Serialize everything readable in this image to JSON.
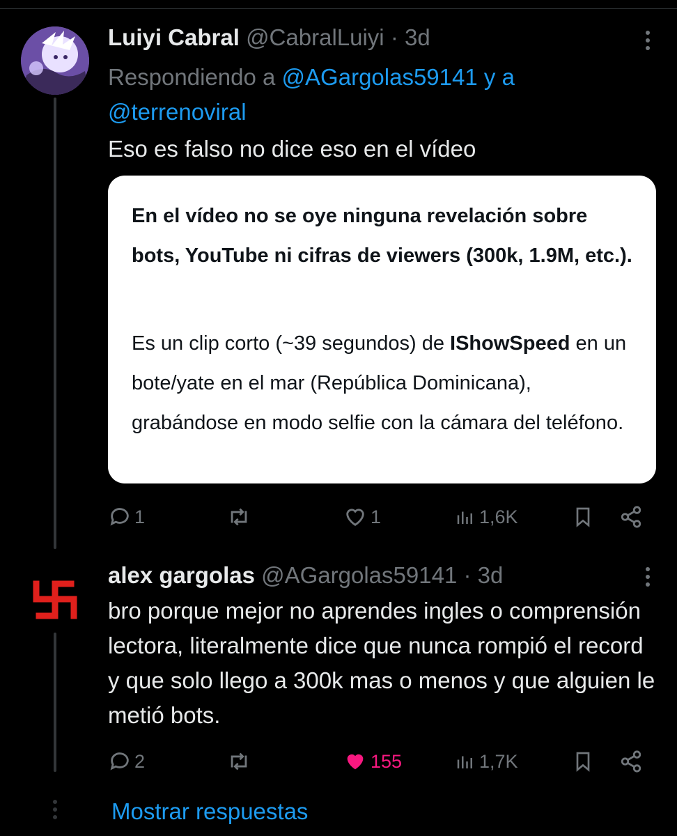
{
  "tweet1": {
    "author_name": "Luiyi Cabral",
    "handle": "@CabralLuiyi",
    "separator": "·",
    "time": "3d",
    "reply_prefix": "Respondiendo a",
    "reply_user1": "@AGargolas59141",
    "reply_and": "y a",
    "reply_user2": "@terrenoviral",
    "text": "Eso es falso no dice eso en el vídeo",
    "card": {
      "bold_text": "En el vídeo no se oye ninguna revelación sobre bots, YouTube ni cifras de viewers (300k, 1.9M, etc.).",
      "text_before": "Es un clip corto (~39 segundos) de",
      "text_bold": "IShowSpeed",
      "text_after": "en un bote/yate en el mar (República Dominicana), grabándose en modo selfie con la cámara del teléfono."
    },
    "actions": {
      "replies": "1",
      "likes": "1",
      "views": "1,6K"
    }
  },
  "tweet2": {
    "author_name": "alex gargolas",
    "handle": "@AGargolas59141",
    "separator": "·",
    "time": "3d",
    "text": "bro porque mejor no aprendes ingles o comprensión lectora, literalmente dice que nunca rompió el record y que solo llego a 300k mas o menos y que alguien le metió bots.",
    "actions": {
      "replies": "2",
      "likes": "155",
      "views": "1,7K"
    }
  },
  "show_replies": "Mostrar respuestas",
  "colors": {
    "background": "#000000",
    "text": "#e7e9ea",
    "secondary": "#71767b",
    "link": "#1d9bf0",
    "like": "#f91880",
    "avatar2_symbol": "#e0201c"
  },
  "icons": [
    "more-icon",
    "reply-icon",
    "retweet-icon",
    "like-icon",
    "views-icon",
    "bookmark-icon",
    "share-icon"
  ]
}
